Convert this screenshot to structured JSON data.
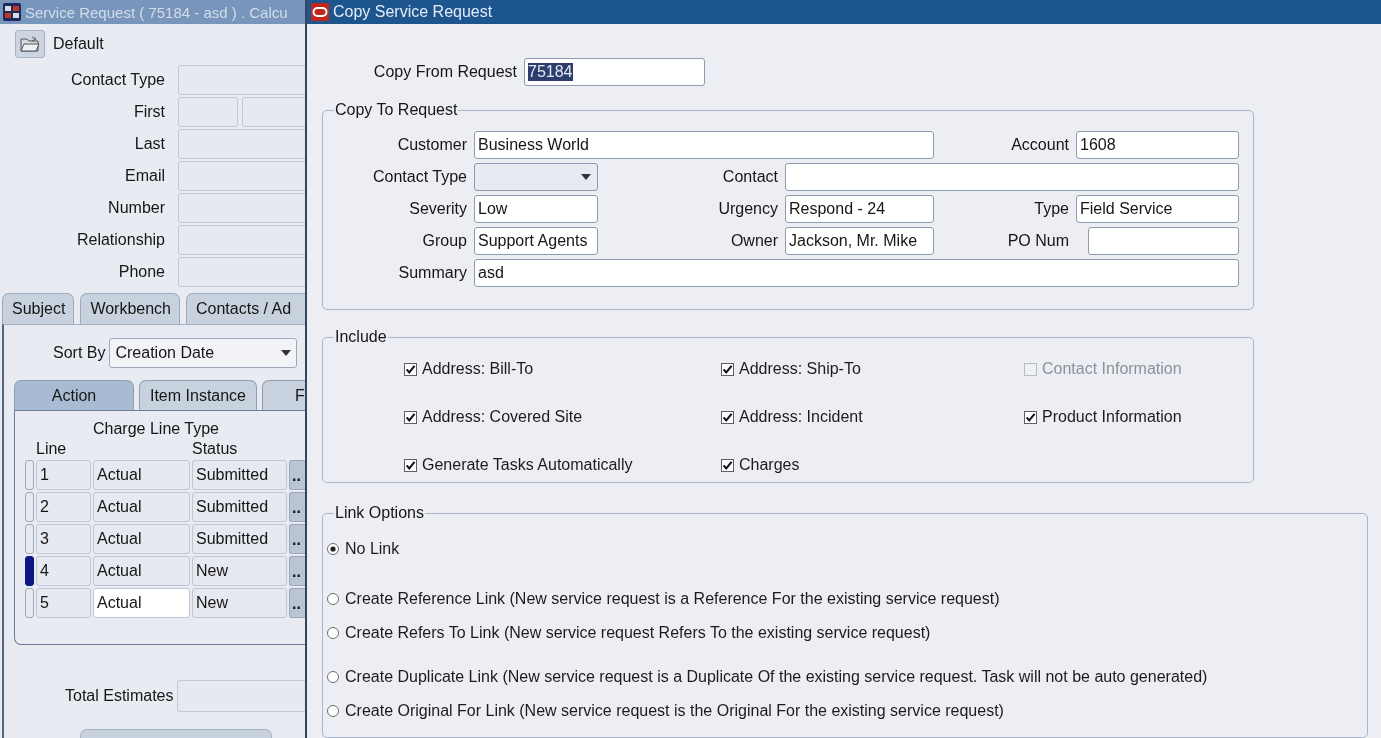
{
  "background_window": {
    "title": "Service Request ( 75184 - asd ) . Calcu",
    "folder_label": "Default",
    "contact_fields": [
      {
        "label": "Contact Type",
        "kind": "single"
      },
      {
        "label": "First",
        "kind": "split"
      },
      {
        "label": "Last",
        "kind": "single"
      },
      {
        "label": "Email",
        "kind": "single"
      },
      {
        "label": "Number",
        "kind": "single"
      },
      {
        "label": "Relationship",
        "kind": "single"
      },
      {
        "label": "Phone",
        "kind": "single"
      }
    ],
    "tabs": [
      {
        "label": "Subject",
        "selected": false
      },
      {
        "label": "Workbench",
        "selected": false
      },
      {
        "label": "Contacts / Ad",
        "selected": false
      }
    ],
    "sort_by": {
      "label": "Sort By",
      "value": "Creation Date"
    },
    "sub_tabs": [
      {
        "label": "Action",
        "selected": true
      },
      {
        "label": "Item Instance",
        "selected": false
      },
      {
        "label": "F",
        "selected": false
      }
    ],
    "table": {
      "columns": [
        "Line",
        "Charge Line Type",
        "Status"
      ],
      "rows": [
        {
          "line": "1",
          "charge_line_type": "Actual",
          "status": "Submitted",
          "more": "..",
          "selected": false,
          "focused": false
        },
        {
          "line": "2",
          "charge_line_type": "Actual",
          "status": "Submitted",
          "more": "..",
          "selected": false,
          "focused": false
        },
        {
          "line": "3",
          "charge_line_type": "Actual",
          "status": "Submitted",
          "more": "..",
          "selected": false,
          "focused": false
        },
        {
          "line": "4",
          "charge_line_type": "Actual",
          "status": "New",
          "more": "..",
          "selected": true,
          "focused": false
        },
        {
          "line": "5",
          "charge_line_type": "Actual",
          "status": "New",
          "more": "..",
          "selected": false,
          "focused": true
        }
      ]
    },
    "total_estimates": {
      "label": "Total Estimates"
    }
  },
  "dialog": {
    "title": "Copy Service Request",
    "copy_from": {
      "label": "Copy From Request",
      "value": "75184",
      "text_selected": true
    },
    "copy_to": {
      "title": "Copy To Request",
      "fields": [
        {
          "label": "Customer",
          "kind": "text",
          "value": "Business World"
        },
        {
          "label": "Account",
          "kind": "text",
          "value": "1608"
        },
        {
          "label": "Contact Type",
          "kind": "select"
        },
        {
          "label": "Contact",
          "kind": "text"
        },
        {
          "label": "Severity",
          "kind": "text",
          "value": "Low"
        },
        {
          "label": "Urgency",
          "kind": "text",
          "value": "Respond - 24"
        },
        {
          "label": "Type",
          "kind": "text",
          "value": "Field Service"
        },
        {
          "label": "Group",
          "kind": "text",
          "value": "Support Agents"
        },
        {
          "label": "Owner",
          "kind": "text",
          "value": "Jackson, Mr. Mike"
        },
        {
          "label": "PO Num",
          "kind": "text"
        },
        {
          "label": "Summary",
          "kind": "text",
          "value": "asd"
        }
      ]
    },
    "include": {
      "title": "Include",
      "options": [
        {
          "label": "Address: Bill-To",
          "checked": true,
          "disabled": false
        },
        {
          "label": "Address: Ship-To",
          "checked": true,
          "disabled": false
        },
        {
          "label": "Contact Information",
          "checked": false,
          "disabled": true
        },
        {
          "label": "Address: Covered Site",
          "checked": true,
          "disabled": false
        },
        {
          "label": "Address: Incident",
          "checked": true,
          "disabled": false
        },
        {
          "label": "Product Information",
          "checked": true,
          "disabled": false
        },
        {
          "label": "Generate Tasks Automatically",
          "checked": true,
          "disabled": false
        },
        {
          "label": "Charges",
          "checked": true,
          "disabled": false
        }
      ]
    },
    "link_options": {
      "title": "Link Options",
      "options": [
        {
          "label": "No Link",
          "selected": true
        },
        {
          "label": "Create Reference Link (New service request is a Reference For the existing service request)",
          "selected": false
        },
        {
          "label": "Create Refers To Link (New service request Refers To the existing service request)",
          "selected": false
        },
        {
          "label": "Create Duplicate Link (New service request is a Duplicate Of the existing service request. Task will not be auto generated)",
          "selected": false
        },
        {
          "label": "Create Original For Link (New service request is the Original For the existing service request)",
          "selected": false
        }
      ]
    }
  }
}
